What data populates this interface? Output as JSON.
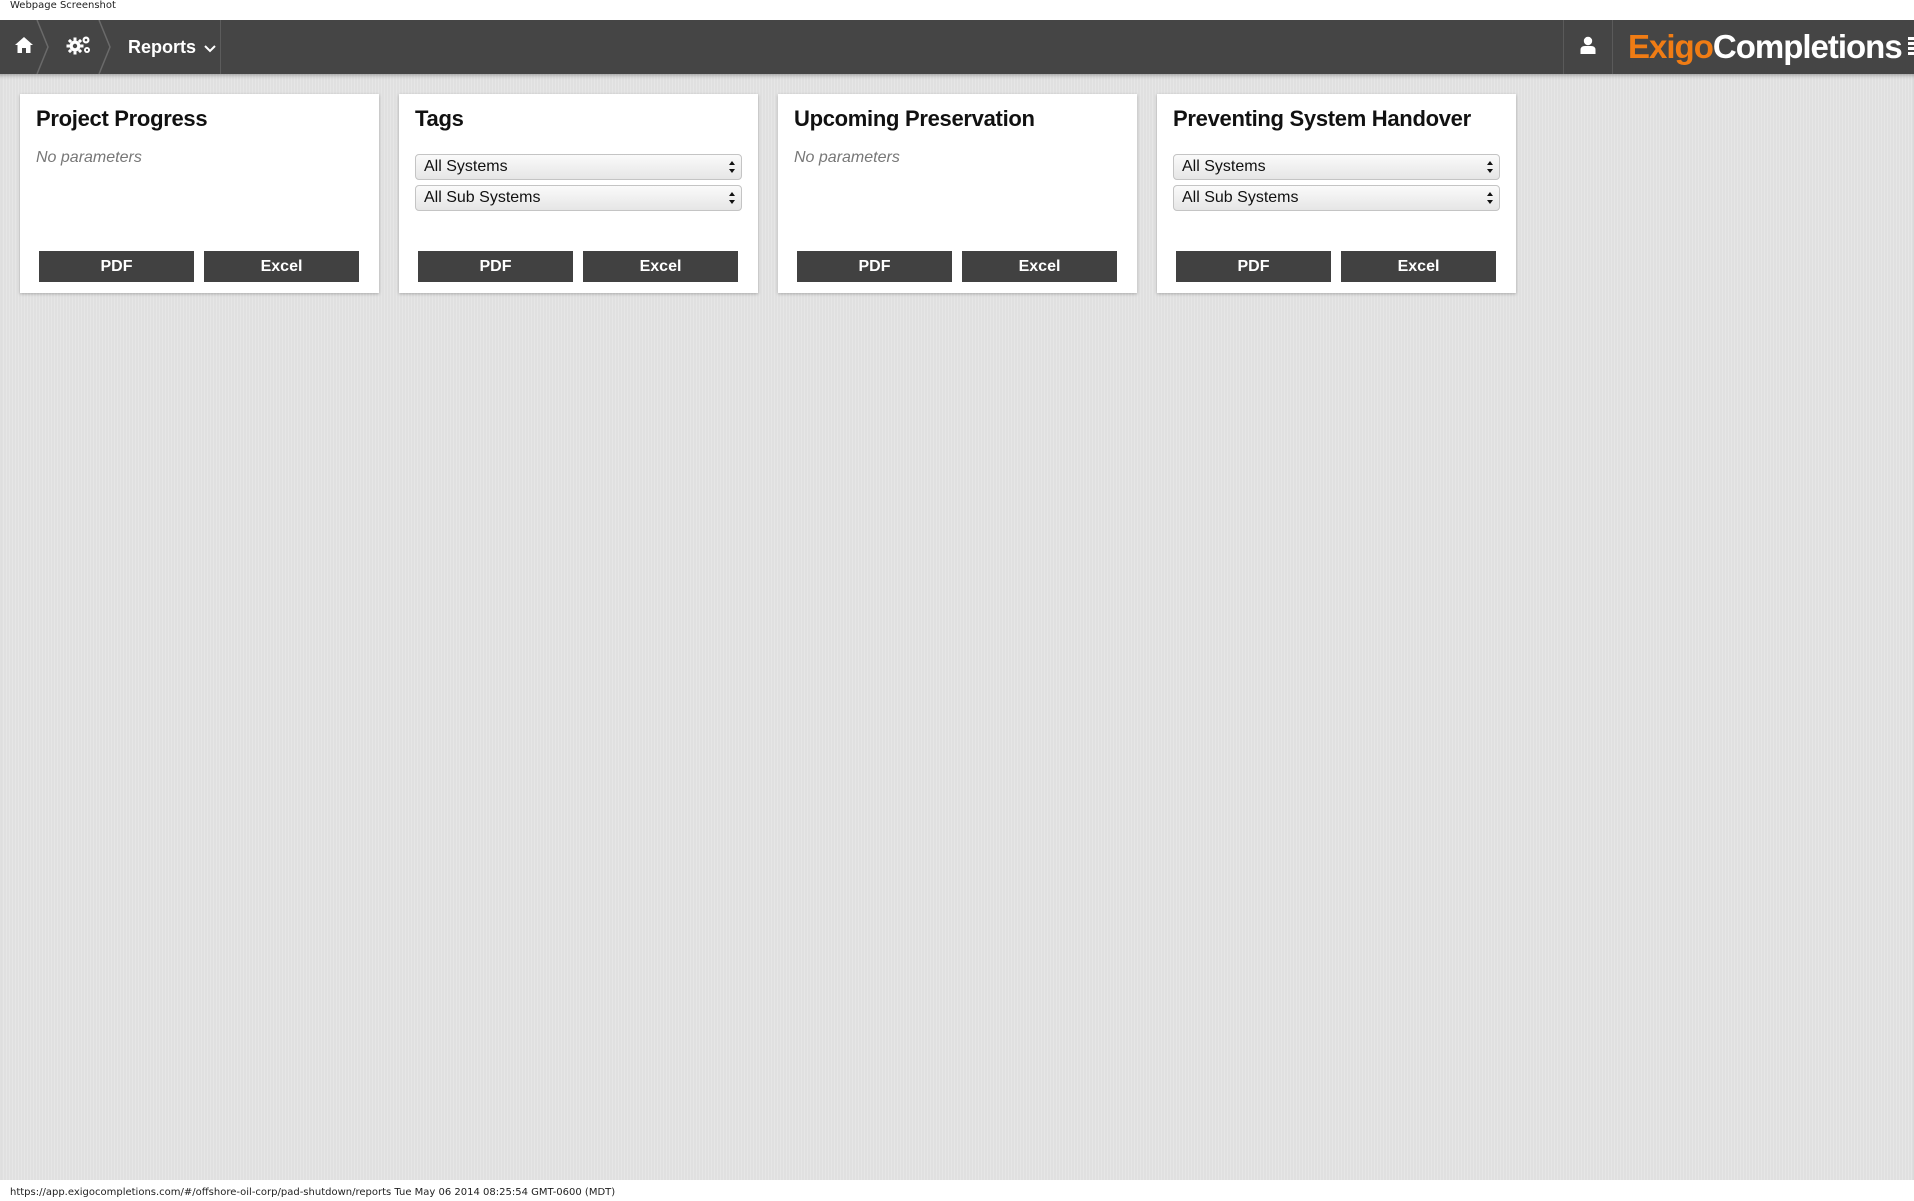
{
  "capture": {
    "label": "Webpage Screenshot",
    "status_line": "https://app.exigocompletions.com/#/offshore-oil-corp/pad-shutdown/reports Tue May 06 2014 08:25:54 GMT-0600 (MDT)"
  },
  "nav": {
    "home_icon": "home-icon",
    "settings_icon": "gears-icon",
    "current_label": "Reports",
    "dropdown_icon": "chevron-down-icon",
    "user_icon": "user-icon"
  },
  "brand": {
    "part1": "Exigo",
    "part2": "Completions",
    "accent_color": "#f07c14"
  },
  "cards": [
    {
      "title": "Project Progress",
      "no_params": "No parameters",
      "pdf": "PDF",
      "excel": "Excel"
    },
    {
      "title": "Tags",
      "system_select": "All Systems",
      "subsystem_select": "All Sub Systems",
      "pdf": "PDF",
      "excel": "Excel"
    },
    {
      "title": "Upcoming Preservation",
      "no_params": "No parameters",
      "pdf": "PDF",
      "excel": "Excel"
    },
    {
      "title": "Preventing System Handover",
      "system_select": "All Systems",
      "subsystem_select": "All Sub Systems",
      "pdf": "PDF",
      "excel": "Excel"
    }
  ]
}
